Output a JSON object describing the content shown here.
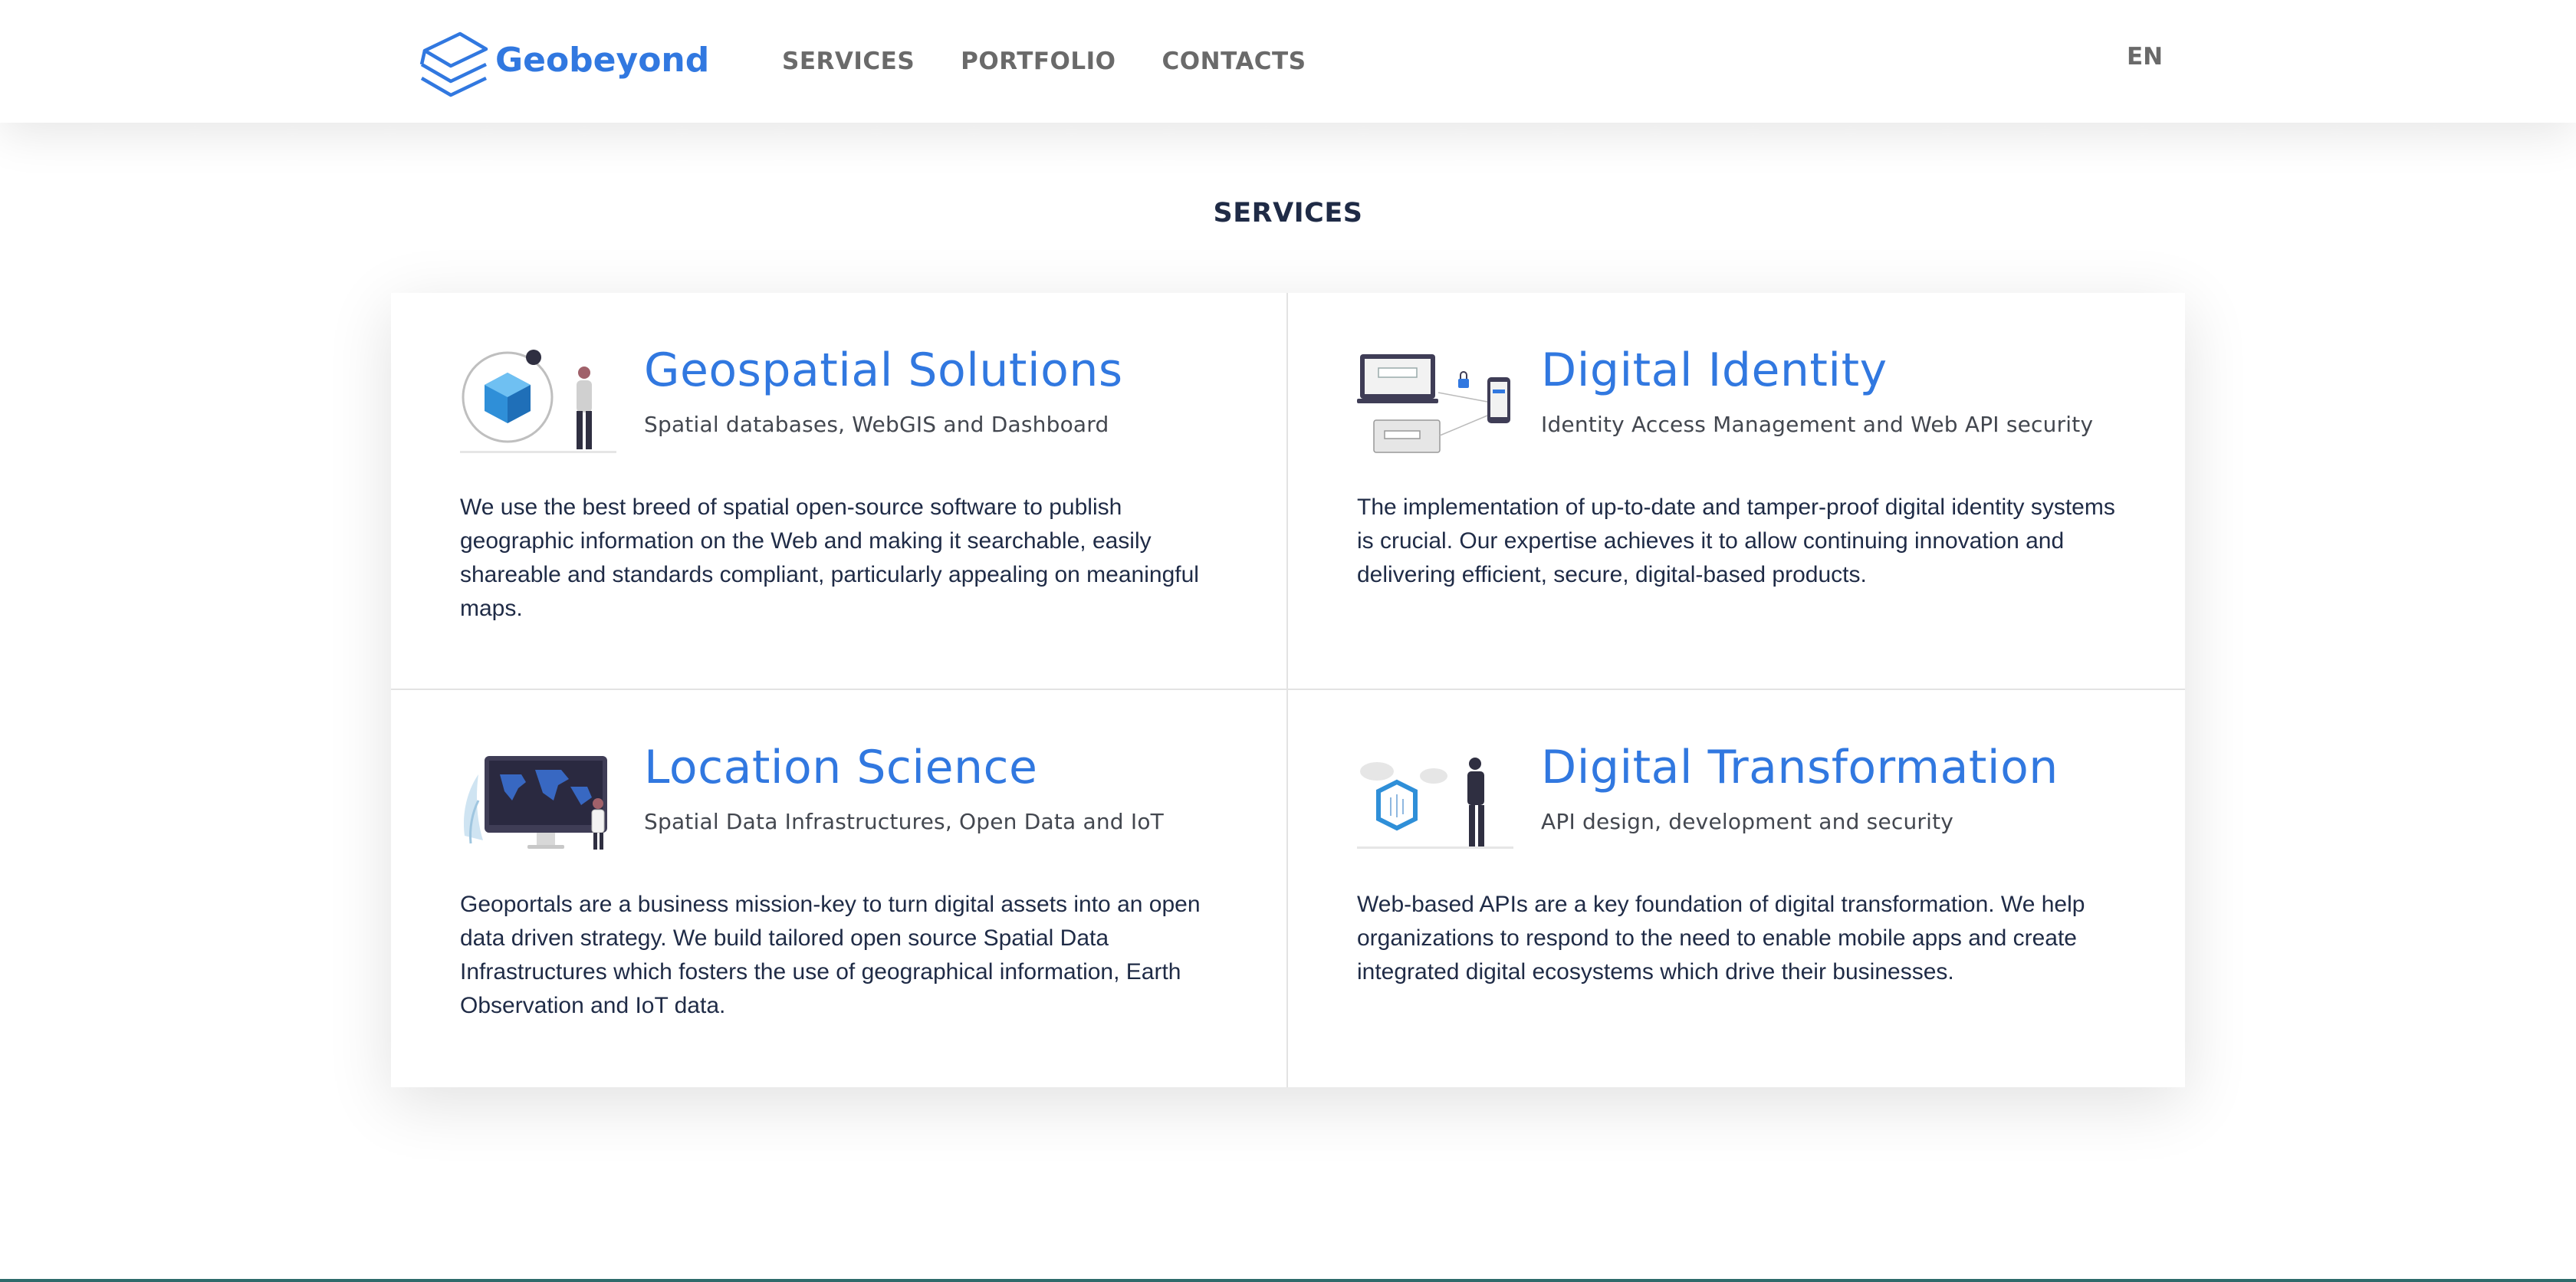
{
  "header": {
    "brand": "Geobeyond",
    "nav": [
      "SERVICES",
      "PORTFOLIO",
      "CONTACTS"
    ],
    "lang": "EN"
  },
  "section_title": "SERVICES",
  "services": [
    {
      "title": "Geospatial Solutions",
      "subtitle": "Spatial databases, WebGIS and Dashboard",
      "text": "We use the best breed of spatial open-source software to publish geographic information on the Web and making it searchable, easily shareable and standards compliant, particularly appealing on meaningful maps."
    },
    {
      "title": "Digital Identity",
      "subtitle": "Identity Access Management and Web API security",
      "text": "The implementation of up-to-date and tamper-proof digital identity systems is crucial. Our expertise achieves it to allow continuing innovation and delivering efficient, secure, digital-based products."
    },
    {
      "title": "Location Science",
      "subtitle": "Spatial Data Infrastructures, Open Data and IoT",
      "text": "Geoportals are a business mission-key to turn digital assets into an open data driven strategy. We build tailored open source Spatial Data Infrastructures which fosters the use of geographical information, Earth Observation and IoT data."
    },
    {
      "title": "Digital Transformation",
      "subtitle": "API design, development and security",
      "text": "Web-based APIs are a key foundation of digital transformation. We help organizations to respond to the need to enable mobile apps and create integrated digital ecosystems which drive their businesses."
    }
  ],
  "colors": {
    "brand": "#3178e0",
    "text": "#1f2b46",
    "nav": "#6a6a6a"
  }
}
